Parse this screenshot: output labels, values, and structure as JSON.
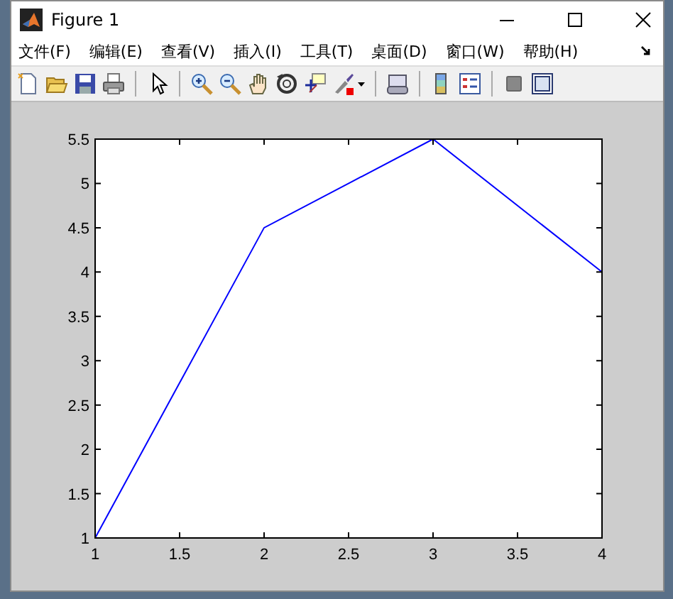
{
  "window": {
    "title": "Figure 1"
  },
  "menu": [
    {
      "label": "文件(F)"
    },
    {
      "label": "编辑(E)"
    },
    {
      "label": "查看(V)"
    },
    {
      "label": "插入(I)"
    },
    {
      "label": "工具(T)"
    },
    {
      "label": "桌面(D)"
    },
    {
      "label": "窗口(W)"
    },
    {
      "label": "帮助(H)"
    }
  ],
  "toolbar": [
    [
      {
        "kind": "new"
      },
      {
        "kind": "open"
      },
      {
        "kind": "save"
      },
      {
        "kind": "print"
      }
    ],
    [
      {
        "kind": "pointer"
      }
    ],
    [
      {
        "kind": "zoom-in"
      },
      {
        "kind": "zoom-out"
      },
      {
        "kind": "pan"
      },
      {
        "kind": "rotate"
      },
      {
        "kind": "cursor"
      },
      {
        "kind": "brush"
      }
    ],
    [
      {
        "kind": "link"
      }
    ],
    [
      {
        "kind": "colorbar"
      },
      {
        "kind": "legend"
      }
    ],
    [
      {
        "kind": "hide"
      },
      {
        "kind": "show"
      }
    ]
  ],
  "chart_data": {
    "type": "line",
    "x": [
      1,
      2,
      3,
      4
    ],
    "series": [
      {
        "color": "#0000ff",
        "values": [
          1,
          4.5,
          5.5,
          4
        ]
      }
    ],
    "xlim": [
      1,
      4
    ],
    "ylim": [
      1,
      5.5
    ],
    "xticks": [
      1,
      {
        "value": 1.5,
        "label": "1.5"
      },
      2,
      {
        "value": 2.5,
        "label": "2.5"
      },
      3,
      {
        "value": 3.5,
        "label": "3.5"
      },
      4
    ],
    "yticks": [
      1,
      {
        "value": 1.5,
        "label": "1.5"
      },
      2,
      {
        "value": 2.5,
        "label": "2.5"
      },
      3,
      {
        "value": 3.5,
        "label": "3.5"
      },
      4,
      {
        "value": 4.5,
        "label": "4.5"
      },
      5,
      {
        "value": 5.5,
        "label": "5.5"
      }
    ]
  }
}
